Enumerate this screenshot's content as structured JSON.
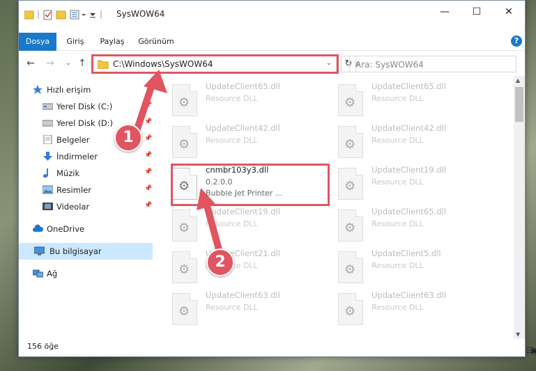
{
  "window": {
    "title": "SysWOW64",
    "controls": {
      "minimize": "—",
      "maximize": "☐",
      "close": "✕"
    }
  },
  "ribbon": {
    "tabs": [
      "Dosya",
      "Giriş",
      "Paylaş",
      "Görünüm"
    ],
    "help": "?"
  },
  "address": {
    "path": "C:\\Windows\\SysWOW64",
    "search_placeholder": "Ara: SysWOW64"
  },
  "sidebar": {
    "items": [
      {
        "label": "Hızlı erişim",
        "icon": "star-icon"
      },
      {
        "label": "Yerel Disk (C:)",
        "icon": "drive-icon",
        "pinned": true
      },
      {
        "label": "Yerel Disk (D:)",
        "icon": "drive-icon",
        "pinned": true
      },
      {
        "label": "Belgeler",
        "icon": "documents-icon",
        "pinned": true
      },
      {
        "label": "İndirmeler",
        "icon": "download-icon",
        "pinned": true
      },
      {
        "label": "Müzik",
        "icon": "music-icon",
        "pinned": true
      },
      {
        "label": "Resimler",
        "icon": "pictures-icon",
        "pinned": true
      },
      {
        "label": "Videolar",
        "icon": "videos-icon",
        "pinned": true
      },
      {
        "label": "OneDrive",
        "icon": "cloud-icon"
      },
      {
        "label": "Bu bilgisayar",
        "icon": "computer-icon",
        "selected": true
      },
      {
        "label": "Ağ",
        "icon": "network-icon"
      }
    ]
  },
  "files": [
    {
      "name": "UpdateClient65.dll",
      "desc": "Resource DLL"
    },
    {
      "name": "UpdateClient65.dll",
      "desc": "Resource DLL"
    },
    {
      "name": "UpdateClient42.dll",
      "desc": "Resource DLL"
    },
    {
      "name": "UpdateClient42.dll",
      "desc": "Resource DLL"
    },
    {
      "name": "cnmbr103y3.dll",
      "desc": "0.2.0.0",
      "desc2": "Bubble Jet Printer ...",
      "highlight": true
    },
    {
      "name": "UpdateClient19.dll",
      "desc": "Resource DLL"
    },
    {
      "name": "UpdateClient19.dll",
      "desc": "Resource DLL"
    },
    {
      "name": "UpdateClient65.dll",
      "desc": "Resource DLL"
    },
    {
      "name": "UpdateClient21.dll",
      "desc": "Resource DLL"
    },
    {
      "name": "UpdateClient5.dll",
      "desc": "Resource DLL"
    },
    {
      "name": "UpdateClient63.dll",
      "desc": "Resource DLL"
    },
    {
      "name": "UpdateClient63.dll",
      "desc": "Resource DLL"
    }
  ],
  "status": {
    "count": "156 öğe"
  },
  "annotations": {
    "badge1": "1",
    "badge2": "2",
    "color": "#e05560"
  }
}
